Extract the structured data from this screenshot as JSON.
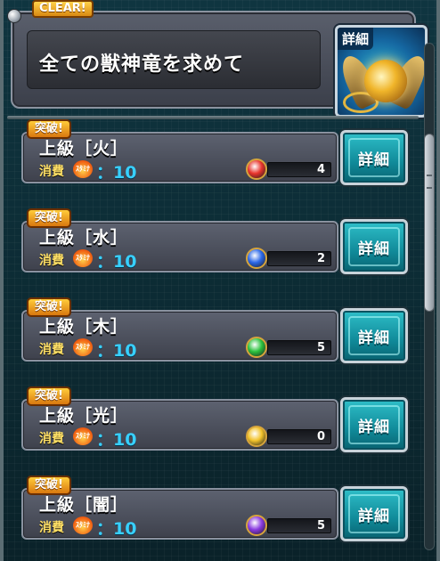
{
  "header": {
    "clear_badge": "CLEAR!",
    "title": "全ての獣神竜を求めて",
    "detail_label": "詳細"
  },
  "rows": [
    {
      "badge": "突破!",
      "title": "上級［火］",
      "cost_label": "消費",
      "stamina": "ｽﾀﾐﾅ",
      "cost_value": "：10",
      "gem_color": "#e8342c",
      "gem_count": "4",
      "detail_label": "詳細"
    },
    {
      "badge": "突破!",
      "title": "上級［水］",
      "cost_label": "消費",
      "stamina": "ｽﾀﾐﾅ",
      "cost_value": "：10",
      "gem_color": "#2c68e8",
      "gem_count": "2",
      "detail_label": "詳細"
    },
    {
      "badge": "突破!",
      "title": "上級［木］",
      "cost_label": "消費",
      "stamina": "ｽﾀﾐﾅ",
      "cost_value": "：10",
      "gem_color": "#2cc23e",
      "gem_count": "5",
      "detail_label": "詳細"
    },
    {
      "badge": "突破!",
      "title": "上級［光］",
      "cost_label": "消費",
      "stamina": "ｽﾀﾐﾅ",
      "cost_value": "：10",
      "gem_color": "#f2c22a",
      "gem_count": "0",
      "detail_label": "詳細"
    },
    {
      "badge": "突破!",
      "title": "上級［闇］",
      "cost_label": "消費",
      "stamina": "ｽﾀﾐﾅ",
      "cost_value": "：10",
      "gem_color": "#8a3ae0",
      "gem_count": "5",
      "detail_label": "詳細"
    }
  ]
}
